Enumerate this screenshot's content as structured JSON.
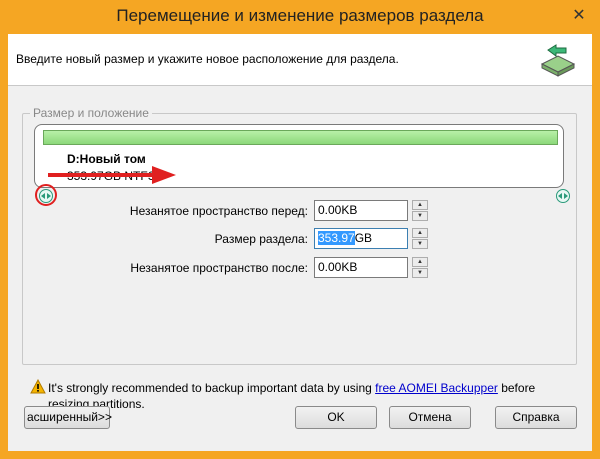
{
  "window": {
    "title": "Перемещение и изменение размеров раздела",
    "close_glyph": "✕",
    "accent_color": "#f5a623"
  },
  "header": {
    "instruction": "Введите новый размер и укажите новое расположение для раздела.",
    "icon": "disk-move-icon"
  },
  "group": {
    "legend": "Размер и положение"
  },
  "partition": {
    "name": "D:Новый том",
    "size_fs": "353.97GB NTFS",
    "bar_color": "#8cd87a"
  },
  "fields": [
    {
      "label": "Незанятое пространство перед:",
      "value": "0.00KB"
    },
    {
      "label": "Размер раздела:",
      "value_selected": "353.97",
      "value_rest": "GB"
    },
    {
      "label": "Незанятое пространство после:",
      "value": "0.00KB"
    }
  ],
  "warning": {
    "text_before": "It's strongly recommended to backup important data by using ",
    "link": "free AOMEI Backupper",
    "text_after": " before resizing partitions."
  },
  "buttons": {
    "advanced": "асширенный>>",
    "ok": "OK",
    "cancel": "Отмена",
    "help": "Справка"
  }
}
